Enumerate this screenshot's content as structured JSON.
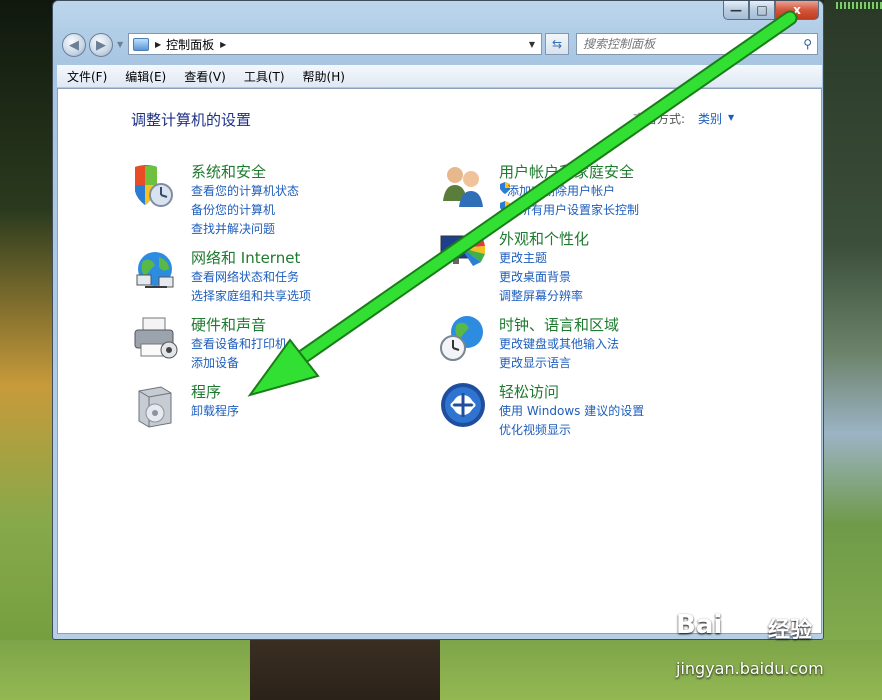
{
  "window": {
    "close_glyph": "x",
    "min_glyph": "—",
    "max_glyph": "□"
  },
  "address": {
    "crumb": "控制面板"
  },
  "search": {
    "placeholder": "搜索控制面板"
  },
  "menu": [
    "文件(F)",
    "编辑(E)",
    "查看(V)",
    "工具(T)",
    "帮助(H)"
  ],
  "page": {
    "title": "调整计算机的设置",
    "view_label": "查看方式:",
    "view_value": "类别"
  },
  "categories": [
    {
      "title": "系统和安全",
      "icon": "shield-icon",
      "links": [
        "查看您的计算机状态",
        "备份您的计算机",
        "查找并解决问题"
      ]
    },
    {
      "title": "网络和 Internet",
      "icon": "network-globe-icon",
      "links": [
        "查看网络状态和任务",
        "选择家庭组和共享选项"
      ]
    },
    {
      "title": "硬件和声音",
      "icon": "printer-icon",
      "links": [
        "查看设备和打印机",
        "添加设备"
      ]
    },
    {
      "title": "程序",
      "icon": "program-box-icon",
      "links": [
        "卸载程序"
      ]
    },
    {
      "title": "用户帐户和家庭安全",
      "icon": "users-icon",
      "links": [
        "添加或删除用户帐户",
        "为所有用户设置家长控制"
      ]
    },
    {
      "title": "外观和个性化",
      "icon": "monitor-palette-icon",
      "links": [
        "更改主题",
        "更改桌面背景",
        "调整屏幕分辨率"
      ]
    },
    {
      "title": "时钟、语言和区域",
      "icon": "clock-globe-icon",
      "links": [
        "更改键盘或其他输入法",
        "更改显示语言"
      ]
    },
    {
      "title": "轻松访问",
      "icon": "ease-of-access-icon",
      "links": [
        "使用 Windows 建议的设置",
        "优化视频显示"
      ]
    }
  ],
  "watermark": {
    "brand": "Bai",
    "brand2": "经验",
    "url": "jingyan.baidu.com"
  },
  "colors": {
    "arrow": "#32e034",
    "title_green": "#1e7a2e",
    "link_blue": "#1e5ebc",
    "heading_blue": "#1e3287"
  }
}
